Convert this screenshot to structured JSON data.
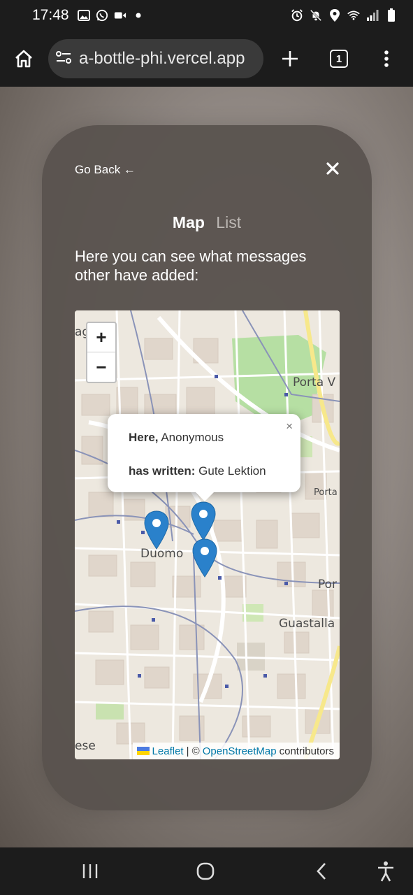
{
  "status_bar": {
    "time": "17:48",
    "left_icons": [
      "gallery-icon",
      "whatsapp-icon",
      "video-icon",
      "dot-icon"
    ],
    "right_icons": [
      "alarm-icon",
      "mute-icon",
      "location-icon",
      "wifi-icon",
      "signal-icon",
      "battery-icon"
    ]
  },
  "browser": {
    "url": "a-bottle-phi.vercel.app",
    "tab_count": "1"
  },
  "card": {
    "go_back": "Go Back ←",
    "tabs": {
      "map": "Map",
      "list": "List"
    },
    "intro": "Here you can see what messages other have added:"
  },
  "map": {
    "zoom_in": "+",
    "zoom_out": "−",
    "place_labels": [
      "Porta V",
      "Porta",
      "Duomo",
      "Por",
      "Guastalla",
      "ag",
      "ese"
    ],
    "popup": {
      "close": "×",
      "here_label": "Here,",
      "author": "Anonymous",
      "written_label": "has written:",
      "message": "Gute Lektion"
    },
    "markers_count": 3,
    "attribution": {
      "leaflet": "Leaflet",
      "separator": " | © ",
      "osm": "OpenStreetMap",
      "contributors": " contributors"
    }
  },
  "colors": {
    "marker_blue": "#2a81cb",
    "link_blue": "#0078a8",
    "card_bg": "#58524e"
  }
}
